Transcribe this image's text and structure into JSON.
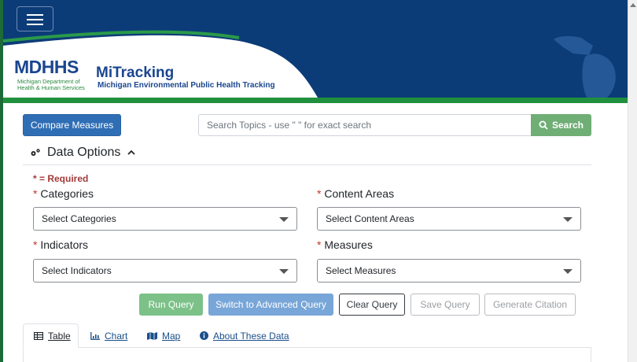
{
  "header": {
    "agency_abbrev": "MDHHS",
    "agency_full": "Michigan Department of Health & Human Services",
    "app_title": "MiTracking",
    "app_subtitle": "Michigan Environmental Public Health Tracking",
    "colors": {
      "navy": "#0c3c78",
      "green": "#21903e",
      "brand_blue": "#1a468f"
    }
  },
  "toolbar": {
    "compare_label": "Compare Measures",
    "search_placeholder": "Search Topics - use \" \" for exact search",
    "search_label": "Search"
  },
  "data_options": {
    "title": "Data Options",
    "required_note": "* = Required",
    "fields": {
      "categories": {
        "label": "Categories",
        "value": "Select Categories"
      },
      "content_areas": {
        "label": "Content Areas",
        "value": "Select Content Areas"
      },
      "indicators": {
        "label": "Indicators",
        "value": "Select Indicators"
      },
      "measures": {
        "label": "Measures",
        "value": "Select Measures"
      }
    },
    "required_mark": "*"
  },
  "actions": {
    "run": "Run Query",
    "switch": "Switch to Advanced Query",
    "clear": "Clear Query",
    "save": "Save Query",
    "cite": "Generate Citation"
  },
  "tabs": [
    {
      "label": "Table",
      "icon": "table-icon"
    },
    {
      "label": "Chart",
      "icon": "chart-icon"
    },
    {
      "label": "Map",
      "icon": "map-icon"
    },
    {
      "label": "About These Data",
      "icon": "info-icon"
    }
  ]
}
